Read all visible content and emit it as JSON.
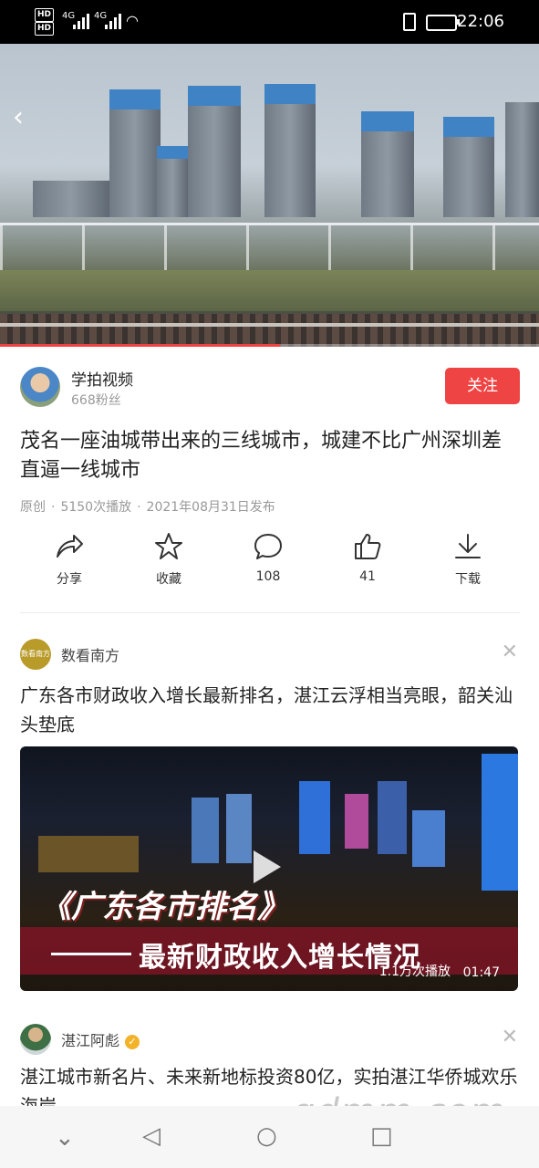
{
  "status_bar": {
    "sim1": "HD",
    "sim2": "HD",
    "network1": "4G",
    "network2": "4G",
    "time": "22:06"
  },
  "video": {
    "progress_fraction": 0.52
  },
  "author": {
    "name": "学拍视频",
    "fans": "668粉丝",
    "follow_label": "关注"
  },
  "article": {
    "title": "茂名一座油城带出来的三线城市，城建不比广州深圳差直逼一线城市",
    "meta_original": "原创",
    "meta_plays": "5150次播放",
    "meta_date": "2021年08月31日发布"
  },
  "actions": [
    {
      "icon": "share-icon",
      "label": "分享"
    },
    {
      "icon": "star-icon",
      "label": "收藏"
    },
    {
      "icon": "comment-icon",
      "label": "108"
    },
    {
      "icon": "like-icon",
      "label": "41"
    },
    {
      "icon": "download-icon",
      "label": "下载"
    }
  ],
  "recommendations": [
    {
      "source": "数看南方",
      "avatar_text": "数看南方",
      "title": "广东各市财政收入增长最新排名，湛江云浮相当亮眼，韶关汕头垫底",
      "thumb_heading": "《广东各市排名》",
      "thumb_sub": "最新财政收入增长情况",
      "plays": "1.1万次播放",
      "duration": "01:47"
    },
    {
      "source": "湛江阿彪",
      "title": "湛江城市新名片、未来新地标投资80亿，实拍湛江华侨城欢乐海岸"
    }
  ],
  "watermark": "gdmm.com",
  "colors": {
    "accent": "#ef4444",
    "progress": "#f04142",
    "verified": "#f2b32a"
  }
}
